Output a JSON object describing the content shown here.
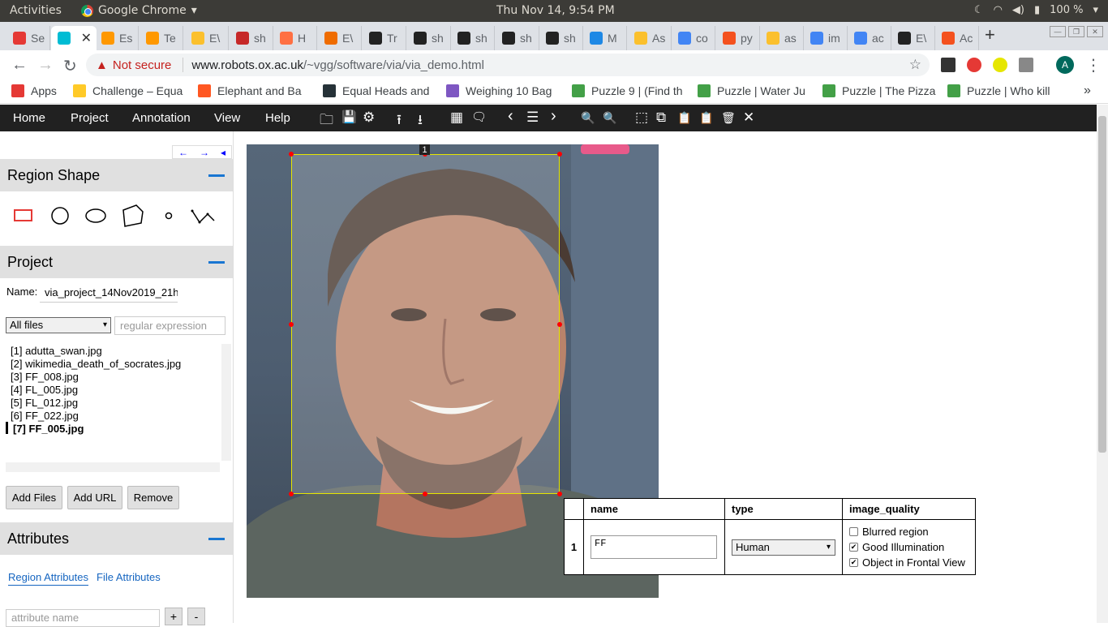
{
  "system": {
    "activities": "Activities",
    "app": "Google Chrome",
    "app_arrow": "▾",
    "clock": "Thu Nov 14,  9:54 PM",
    "battery": "100 %",
    "tray_arrow": "▾"
  },
  "tabs": [
    {
      "label": "Se",
      "color": "#e53935"
    },
    {
      "label": "",
      "color": "#00bcd4"
    },
    {
      "label": "Es",
      "color": "#ff9800"
    },
    {
      "label": "Te",
      "color": "#ff9800"
    },
    {
      "label": "E\\",
      "color": "#fbc02d"
    },
    {
      "label": "sh",
      "color": "#c62828"
    },
    {
      "label": "H",
      "color": "#ff7043"
    },
    {
      "label": "E\\",
      "color": "#ef6c00"
    },
    {
      "label": "Tr",
      "color": "#222222"
    },
    {
      "label": "sh",
      "color": "#222222"
    },
    {
      "label": "sh",
      "color": "#222222"
    },
    {
      "label": "sh",
      "color": "#222222"
    },
    {
      "label": "sh",
      "color": "#222222"
    },
    {
      "label": "M",
      "color": "#1e88e5"
    },
    {
      "label": "As",
      "color": "#fbc02d"
    },
    {
      "label": "co",
      "color": "#4285f4"
    },
    {
      "label": "py",
      "color": "#f4511e"
    },
    {
      "label": "as",
      "color": "#fbc02d"
    },
    {
      "label": "im",
      "color": "#4285f4"
    },
    {
      "label": "ac",
      "color": "#4285f4"
    },
    {
      "label": "E\\",
      "color": "#222222"
    },
    {
      "label": "Ac",
      "color": "#f4511e"
    }
  ],
  "new_tab": "+",
  "nav": {
    "back": "←",
    "forward": "→",
    "reload": "↻",
    "warning": "▲",
    "not_secure": "Not secure",
    "host": "www.robots.ox.ac.uk",
    "path": "/~vgg/software/via/via_demo.html",
    "star": "☆",
    "profile": "A",
    "menu": "⋮"
  },
  "bookmarks": [
    {
      "label": "Apps",
      "color": "#e53935"
    },
    {
      "label": "Challenge – Equa",
      "color": "#ffca28"
    },
    {
      "label": "Elephant and Ba",
      "color": "#ff5722"
    },
    {
      "label": "Equal Heads and",
      "color": "#263238"
    },
    {
      "label": "Weighing 10 Bag",
      "color": "#7e57c2"
    },
    {
      "label": "Puzzle 9 | (Find th",
      "color": "#43a047"
    },
    {
      "label": "Puzzle | Water Ju",
      "color": "#43a047"
    },
    {
      "label": "Puzzle | The Pizza",
      "color": "#43a047"
    },
    {
      "label": "Puzzle | Who kill",
      "color": "#43a047"
    }
  ],
  "bookmarks_more": "»",
  "via_menu": {
    "home": "Home",
    "project": "Project",
    "annotation": "Annotation",
    "view": "View",
    "help": "Help"
  },
  "toolbar_icons": {
    "open": "🗀",
    "save": "💾",
    "settings": "⚙",
    "upload": "⭱",
    "download": "⭳",
    "grid": "▦",
    "comment": "🗨",
    "prev": "‹",
    "list": "☰",
    "next": "›",
    "zoom_in": "🔍",
    "zoom_out": "🔍",
    "select_all": "⬚",
    "copy": "⧉",
    "paste": "📋",
    "paste_n": "📋",
    "delete": "🗑",
    "close": "✕"
  },
  "panel_nav": {
    "left": "←",
    "right": "→",
    "collapse": "◂"
  },
  "region_shape": {
    "title": "Region Shape"
  },
  "project": {
    "title": "Project",
    "name_label": "Name:",
    "name_value": "via_project_14Nov2019_21h",
    "filter_value": "All files",
    "filter_arrow": "▾",
    "regex_placeholder": "regular expression",
    "files": [
      "[1] adutta_swan.jpg",
      "[2] wikimedia_death_of_socrates.jpg",
      "[3] FF_008.jpg",
      "[4] FL_005.jpg",
      "[5] FL_012.jpg",
      "[6] FF_022.jpg",
      "[7] FF_005.jpg"
    ],
    "add_files": "Add Files",
    "add_url": "Add URL",
    "remove": "Remove"
  },
  "attributes": {
    "title": "Attributes",
    "region_tab": "Region Attributes",
    "file_tab": "File Attributes",
    "name_placeholder": "attribute name",
    "add": "+",
    "del": "-"
  },
  "canvas": {
    "region_id": "1"
  },
  "annotation_table": {
    "headers": [
      "name",
      "type",
      "image_quality"
    ],
    "row_id": "1",
    "name_value": "FF",
    "type_value": "Human",
    "type_arrow": "▾",
    "quality_options": [
      {
        "label": "Blurred region",
        "checked": false
      },
      {
        "label": "Good Illumination",
        "checked": true
      },
      {
        "label": "Object in Frontal View",
        "checked": true
      }
    ]
  },
  "colors": {
    "accent": "#1976d2",
    "menubar": "#212121",
    "bbox": "#e6e600",
    "handle": "#ff0000"
  }
}
